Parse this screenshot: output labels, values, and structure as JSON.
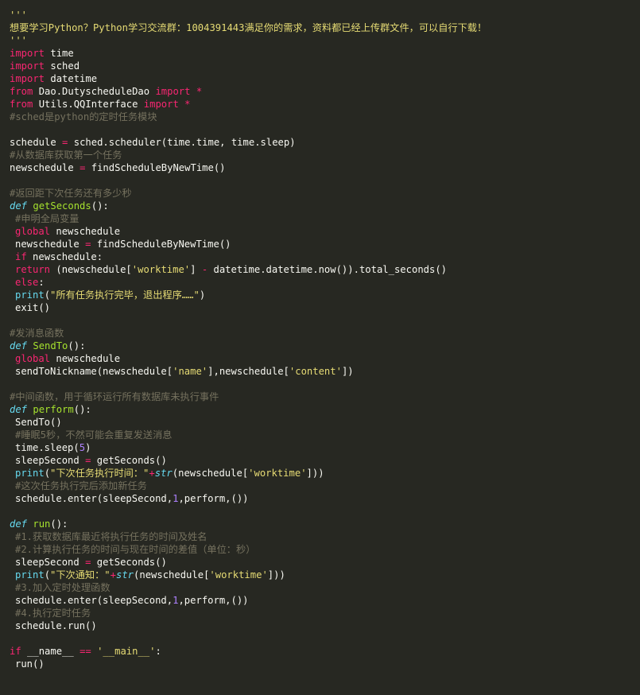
{
  "colors": {
    "background": "#272822",
    "keyword": "#f92672",
    "def_keyword": "#66d9ef",
    "function_name": "#a6e22e",
    "string": "#e6db74",
    "comment": "#75715e",
    "number": "#ae81ff",
    "text": "#f8f8f2"
  },
  "code": {
    "lines": [
      {
        "indent": false,
        "tokens": [
          [
            "str",
            "'''"
          ]
        ]
      },
      {
        "indent": false,
        "tokens": [
          [
            "str",
            "想要学习Python？Python学习交流群：1004391443满足你的需求，资料都已经上传群文件，可以自行下载！"
          ]
        ]
      },
      {
        "indent": false,
        "tokens": [
          [
            "str",
            "'''"
          ]
        ]
      },
      {
        "indent": false,
        "tokens": [
          [
            "kw",
            "import"
          ],
          [
            "plain",
            " time"
          ]
        ]
      },
      {
        "indent": false,
        "tokens": [
          [
            "kw",
            "import"
          ],
          [
            "plain",
            " sched"
          ]
        ]
      },
      {
        "indent": false,
        "tokens": [
          [
            "kw",
            "import"
          ],
          [
            "plain",
            " datetime"
          ]
        ]
      },
      {
        "indent": false,
        "tokens": [
          [
            "kw",
            "from"
          ],
          [
            "plain",
            " Dao.DutyscheduleDao "
          ],
          [
            "kw",
            "import"
          ],
          [
            "plain",
            " "
          ],
          [
            "kw",
            "*"
          ]
        ]
      },
      {
        "indent": false,
        "tokens": [
          [
            "kw",
            "from"
          ],
          [
            "plain",
            " Utils.QQInterface "
          ],
          [
            "kw",
            "import"
          ],
          [
            "plain",
            " "
          ],
          [
            "kw",
            "*"
          ]
        ]
      },
      {
        "indent": false,
        "tokens": [
          [
            "cm",
            "#sched是python的定时任务模块"
          ]
        ]
      },
      {
        "indent": false,
        "tokens": []
      },
      {
        "indent": false,
        "tokens": [
          [
            "plain",
            "schedule "
          ],
          [
            "op",
            "="
          ],
          [
            "plain",
            " sched.scheduler(time.time, time.sleep)"
          ]
        ]
      },
      {
        "indent": false,
        "tokens": [
          [
            "cm",
            "#从数据库获取第一个任务"
          ]
        ]
      },
      {
        "indent": false,
        "tokens": [
          [
            "plain",
            "newschedule "
          ],
          [
            "op",
            "="
          ],
          [
            "plain",
            " findScheduleByNewTime()"
          ]
        ]
      },
      {
        "indent": false,
        "tokens": []
      },
      {
        "indent": false,
        "tokens": [
          [
            "cm",
            "#返回距下次任务还有多少秒"
          ]
        ]
      },
      {
        "indent": false,
        "tokens": [
          [
            "def",
            "def"
          ],
          [
            "plain",
            " "
          ],
          [
            "fn",
            "getSeconds"
          ],
          [
            "plain",
            "():"
          ]
        ]
      },
      {
        "indent": true,
        "tokens": [
          [
            "cm",
            "#申明全局变量"
          ]
        ]
      },
      {
        "indent": true,
        "tokens": [
          [
            "kw",
            "global"
          ],
          [
            "plain",
            " newschedule"
          ]
        ]
      },
      {
        "indent": true,
        "tokens": [
          [
            "plain",
            "newschedule "
          ],
          [
            "op",
            "="
          ],
          [
            "plain",
            " findScheduleByNewTime()"
          ]
        ]
      },
      {
        "indent": true,
        "tokens": [
          [
            "kw",
            "if"
          ],
          [
            "plain",
            " newschedule:"
          ]
        ]
      },
      {
        "indent": true,
        "tokens": [
          [
            "kw",
            "return"
          ],
          [
            "plain",
            " (newschedule["
          ],
          [
            "str",
            "'worktime'"
          ],
          [
            "plain",
            "] "
          ],
          [
            "op",
            "-"
          ],
          [
            "plain",
            " datetime.datetime.now()).total_seconds()"
          ]
        ]
      },
      {
        "indent": true,
        "tokens": [
          [
            "kw",
            "else"
          ],
          [
            "plain",
            ":"
          ]
        ]
      },
      {
        "indent": true,
        "tokens": [
          [
            "bi",
            "print"
          ],
          [
            "plain",
            "("
          ],
          [
            "str",
            "\"所有任务执行完毕，退出程序……\""
          ],
          [
            "plain",
            ")"
          ]
        ]
      },
      {
        "indent": true,
        "tokens": [
          [
            "plain",
            "exit()"
          ]
        ]
      },
      {
        "indent": false,
        "tokens": []
      },
      {
        "indent": false,
        "tokens": [
          [
            "cm",
            "#发消息函数"
          ]
        ]
      },
      {
        "indent": false,
        "tokens": [
          [
            "def",
            "def"
          ],
          [
            "plain",
            " "
          ],
          [
            "fn",
            "SendTo"
          ],
          [
            "plain",
            "():"
          ]
        ]
      },
      {
        "indent": true,
        "tokens": [
          [
            "kw",
            "global"
          ],
          [
            "plain",
            " newschedule"
          ]
        ]
      },
      {
        "indent": true,
        "tokens": [
          [
            "plain",
            "sendToNickname(newschedule["
          ],
          [
            "str",
            "'name'"
          ],
          [
            "plain",
            "],newschedule["
          ],
          [
            "str",
            "'content'"
          ],
          [
            "plain",
            "])"
          ]
        ]
      },
      {
        "indent": false,
        "tokens": []
      },
      {
        "indent": false,
        "tokens": [
          [
            "cm",
            "#中间函数，用于循环运行所有数据库未执行事件"
          ]
        ]
      },
      {
        "indent": false,
        "tokens": [
          [
            "def",
            "def"
          ],
          [
            "plain",
            " "
          ],
          [
            "fn",
            "perform"
          ],
          [
            "plain",
            "():"
          ]
        ]
      },
      {
        "indent": true,
        "tokens": [
          [
            "plain",
            "SendTo()"
          ]
        ]
      },
      {
        "indent": true,
        "tokens": [
          [
            "cm",
            "#睡眠5秒，不然可能会重复发送消息"
          ]
        ]
      },
      {
        "indent": true,
        "tokens": [
          [
            "plain",
            "time.sleep("
          ],
          [
            "num",
            "5"
          ],
          [
            "plain",
            ")"
          ]
        ]
      },
      {
        "indent": true,
        "tokens": [
          [
            "plain",
            "sleepSecond "
          ],
          [
            "op",
            "="
          ],
          [
            "plain",
            " getSeconds()"
          ]
        ]
      },
      {
        "indent": true,
        "tokens": [
          [
            "bi",
            "print"
          ],
          [
            "plain",
            "("
          ],
          [
            "str",
            "\"下次任务执行时间：\""
          ],
          [
            "op",
            "+"
          ],
          [
            "def",
            "str"
          ],
          [
            "plain",
            "(newschedule["
          ],
          [
            "str",
            "'worktime'"
          ],
          [
            "plain",
            "]))"
          ]
        ]
      },
      {
        "indent": true,
        "tokens": [
          [
            "cm",
            "#这次任务执行完后添加新任务"
          ]
        ]
      },
      {
        "indent": true,
        "tokens": [
          [
            "plain",
            "schedule.enter(sleepSecond,"
          ],
          [
            "num",
            "1"
          ],
          [
            "plain",
            ",perform,())"
          ]
        ]
      },
      {
        "indent": false,
        "tokens": []
      },
      {
        "indent": false,
        "tokens": [
          [
            "def",
            "def"
          ],
          [
            "plain",
            " "
          ],
          [
            "fn",
            "run"
          ],
          [
            "plain",
            "():"
          ]
        ]
      },
      {
        "indent": true,
        "tokens": [
          [
            "cm",
            "#1.获取数据库最近将执行任务的时间及姓名"
          ]
        ]
      },
      {
        "indent": true,
        "tokens": [
          [
            "cm",
            "#2.计算执行任务的时间与现在时间的差值（单位：秒）"
          ]
        ]
      },
      {
        "indent": true,
        "tokens": [
          [
            "plain",
            "sleepSecond "
          ],
          [
            "op",
            "="
          ],
          [
            "plain",
            " getSeconds()"
          ]
        ]
      },
      {
        "indent": true,
        "tokens": [
          [
            "bi",
            "print"
          ],
          [
            "plain",
            "("
          ],
          [
            "str",
            "\"下次通知：\""
          ],
          [
            "op",
            "+"
          ],
          [
            "def",
            "str"
          ],
          [
            "plain",
            "(newschedule["
          ],
          [
            "str",
            "'worktime'"
          ],
          [
            "plain",
            "]))"
          ]
        ]
      },
      {
        "indent": true,
        "tokens": [
          [
            "cm",
            "#3.加入定时处理函数"
          ]
        ]
      },
      {
        "indent": true,
        "tokens": [
          [
            "plain",
            "schedule.enter(sleepSecond,"
          ],
          [
            "num",
            "1"
          ],
          [
            "plain",
            ",perform,())"
          ]
        ]
      },
      {
        "indent": true,
        "tokens": [
          [
            "cm",
            "#4.执行定时任务"
          ]
        ]
      },
      {
        "indent": true,
        "tokens": [
          [
            "plain",
            "schedule.run()"
          ]
        ]
      },
      {
        "indent": false,
        "tokens": []
      },
      {
        "indent": false,
        "tokens": [
          [
            "kw",
            "if"
          ],
          [
            "plain",
            " __name__ "
          ],
          [
            "op",
            "=="
          ],
          [
            "plain",
            " "
          ],
          [
            "str",
            "'__main__'"
          ],
          [
            "plain",
            ":"
          ]
        ]
      },
      {
        "indent": true,
        "tokens": [
          [
            "plain",
            "run()"
          ]
        ]
      }
    ]
  }
}
